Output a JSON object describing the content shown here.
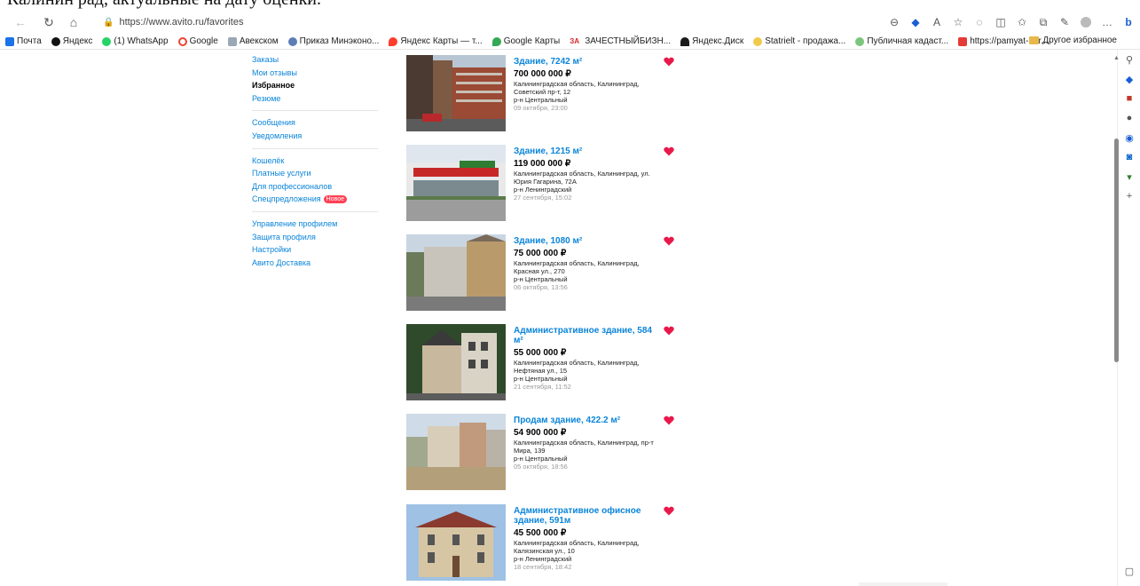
{
  "caption": "Калинин рад, актуальные на дату оценки.",
  "browser": {
    "url": "https://www.avito.ru/favorites",
    "bookmarks": [
      "Почта",
      "Яндекс",
      "(1) WhatsApp",
      "Google",
      "Авекском",
      "Приказ Минэконо...",
      "Яндекс Карты — т...",
      "Google Карты",
      "ЗАЧЕСТНЫЙБИЗН...",
      "Яндекс.Диск",
      "Statrielt - продажа...",
      "Публичная кадаст...",
      "https://pamyat-nar..."
    ],
    "other_bookmarks": "Другое избранное"
  },
  "menu": {
    "orders": "Заказы",
    "reviews": "Мои отзывы",
    "favorites": "Избранное",
    "resume": "Резюме",
    "messages": "Сообщения",
    "notifications": "Уведомления",
    "wallet": "Кошелёк",
    "paid": "Платные услуги",
    "pro": "Для профессионалов",
    "offers": "Спецпредложения",
    "new_badge": "Новое",
    "profile_mgmt": "Управление профилем",
    "protection": "Защита профиля",
    "settings": "Настройки",
    "delivery": "Авито Доставка"
  },
  "listings": [
    {
      "title": "Здание, 7242 м²",
      "price": "700 000 000 ₽",
      "address": "Калининградская область, Калининград, Советский пр-т, 12",
      "district": "р-н Центральный",
      "date": "09 октября, 23:00"
    },
    {
      "title": "Здание, 1215 м²",
      "price": "119 000 000 ₽",
      "address": "Калининградская область, Калининград, ул. Юрия Гагарина, 72А",
      "district": "р-н Ленинградский",
      "date": "27 сентября, 15:02"
    },
    {
      "title": "Здание, 1080 м²",
      "price": "75 000 000 ₽",
      "address": "Калининградская область, Калининград, Красная ул., 270",
      "district": "р-н Центральный",
      "date": "06 октября, 13:56"
    },
    {
      "title": "Административное здание, 584 м²",
      "price": "55 000 000 ₽",
      "address": "Калининградская область, Калининград, Нефтяная ул., 15",
      "district": "р-н Центральный",
      "date": "21 сентября, 11:52"
    },
    {
      "title": "Продам здание, 422.2 м²",
      "price": "54 900 000 ₽",
      "address": "Калининградская область, Калининград, пр-т Мира, 139",
      "district": "р-н Центральный",
      "date": "05 октября, 18:56"
    },
    {
      "title": "Административное офисное здание, 591м",
      "price": "45 500 000 ₽",
      "address": "Калининградская область, Калининград, Калязинская ул., 10",
      "district": "р-н Ленинградский",
      "date": "18 сентября, 18:42"
    }
  ]
}
